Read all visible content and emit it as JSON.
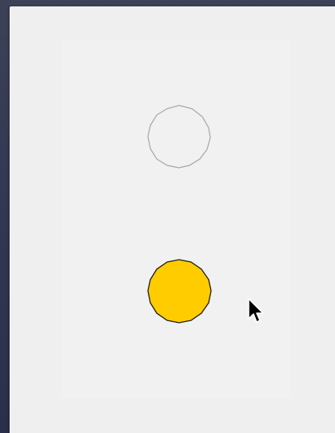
{
  "window": {
    "background": "#efefef",
    "canvas_background": "#f1f1f1"
  },
  "circles": [
    {
      "name": "empty-circle",
      "fill": "none",
      "stroke": "#a6a6a6"
    },
    {
      "name": "yellow-filled-circle",
      "fill": "#ffcc00",
      "stroke": "#1a1a1a"
    }
  ],
  "cursor": {
    "icon": "arrow-cursor-icon"
  },
  "colors": {
    "desktop": "#353a54",
    "accent_yellow": "#ffcc00"
  }
}
